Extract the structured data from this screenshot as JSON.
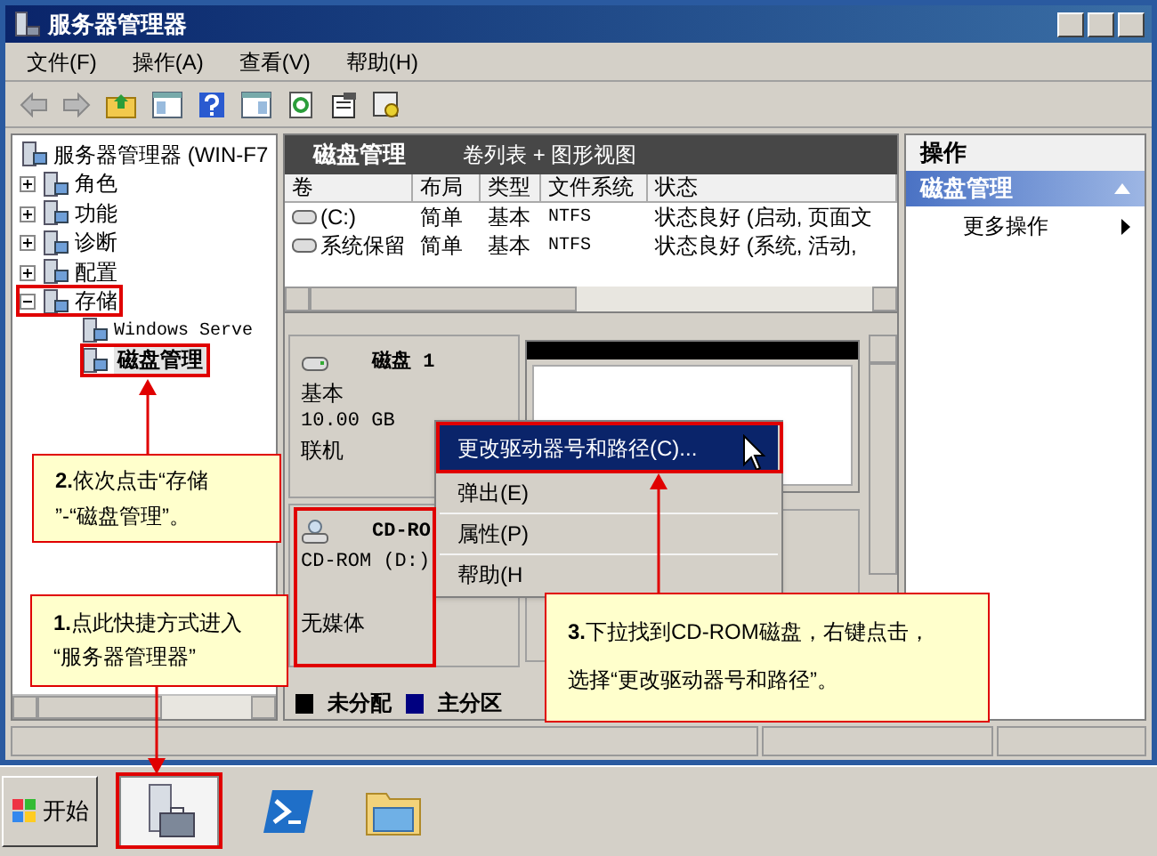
{
  "window": {
    "title": "服务器管理器"
  },
  "menu": [
    "文件(F)",
    "操作(A)",
    "查看(V)",
    "帮助(H)"
  ],
  "tree": {
    "label": "服务器管理器 (WIN-F7",
    "selected": false,
    "children": [
      {
        "label": "角色",
        "expanded": false,
        "selected": false
      },
      {
        "label": "功能",
        "expanded": false,
        "selected": false
      },
      {
        "label": "诊断",
        "expanded": false,
        "selected": false
      },
      {
        "label": "配置",
        "expanded": false,
        "selected": false
      },
      {
        "label": "存储",
        "expanded": true,
        "selected": false,
        "children": [
          {
            "label": "Windows Serve",
            "selected": false
          },
          {
            "label": "磁盘管理",
            "selected": true
          }
        ]
      }
    ]
  },
  "panel": {
    "title": "磁盘管理",
    "view": "卷列表 + 图形视图"
  },
  "table": {
    "columns": [
      "卷",
      "布局",
      "类型",
      "文件系统",
      "状态"
    ],
    "rows": [
      [
        "(C:)",
        "简单",
        "基本",
        "NTFS",
        "状态良好 (启动, 页面文"
      ],
      [
        "系统保留",
        "简单",
        "基本",
        "NTFS",
        "状态良好 (系统, 活动,"
      ]
    ]
  },
  "disks": [
    {
      "kind": "disk",
      "name": "磁盘 1",
      "lines": [
        "基本",
        "10.00 GB",
        "联机"
      ]
    },
    {
      "kind": "cdrom",
      "name": "CD-RO",
      "lines": [
        "CD-ROM (D:)",
        "无媒体"
      ]
    }
  ],
  "legend": [
    {
      "label": "未分配",
      "color": "#000000"
    },
    {
      "label": "主分区",
      "color": "#000080"
    }
  ],
  "context_menu": [
    {
      "label": "更改驱动器号和路径(C)...",
      "selected": true
    },
    {
      "label": "弹出(E)",
      "selected": false
    },
    {
      "label": "属性(P)",
      "selected": false
    },
    {
      "label": "帮助(H",
      "selected": false
    }
  ],
  "actions": {
    "title": "操作",
    "section": "磁盘管理",
    "items": [
      "更多操作"
    ]
  },
  "taskbar": {
    "start": "开始"
  },
  "callouts": [
    {
      "lines": [
        "**2.**依次点击“存储",
        "”-“磁盘管理”。"
      ]
    },
    {
      "lines": [
        "**1.**点此快捷方式进入",
        "“服务器管理器”"
      ]
    },
    {
      "lines": [
        "**3.**下拉找到CD-ROM磁盘，右键点击，",
        "选择“更改驱动器号和路径”。"
      ]
    }
  ]
}
